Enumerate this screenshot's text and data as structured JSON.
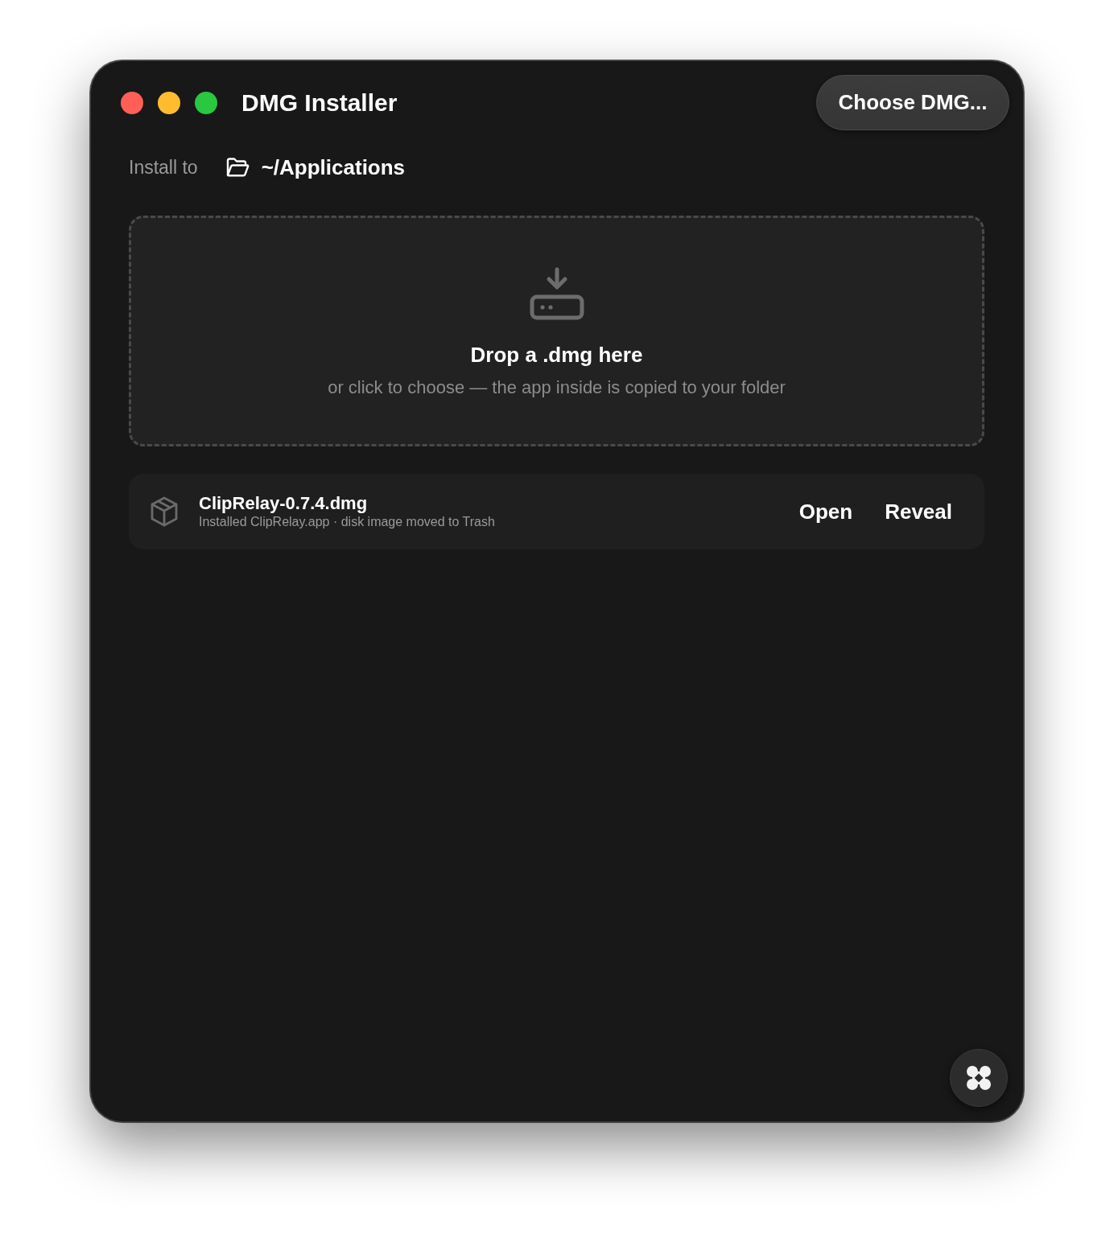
{
  "window": {
    "title": "DMG Installer"
  },
  "toolbar": {
    "choose_button": "Choose DMG..."
  },
  "destination": {
    "label": "Install to",
    "path": "~/Applications"
  },
  "drop_zone": {
    "title": "Drop a .dmg here",
    "subtitle": "or click to choose — the app inside is copied to your folder"
  },
  "installs": [
    {
      "name": "ClipRelay-0.7.4.dmg",
      "detail": "Installed ClipRelay.app · disk image moved to Trash",
      "actions": [
        "Open",
        "Reveal"
      ]
    }
  ]
}
